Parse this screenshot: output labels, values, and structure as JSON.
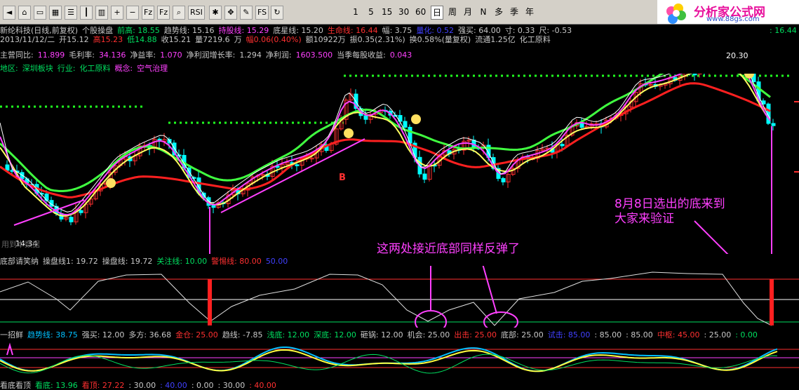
{
  "toolbar": {
    "icons": [
      "back-icon",
      "home-icon",
      "window-icon",
      "grid-icon",
      "list-icon",
      "candlestick-icon",
      "bar-chart-icon",
      "plus-icon",
      "minus-icon",
      "fz-icon",
      "fz2-icon",
      "magnify-icon",
      "rsi-icon",
      "gear-icon",
      "move-icon",
      "edit-icon",
      "fs-icon",
      "refresh-icon"
    ],
    "rsi_label": "RSI",
    "fs_label": "FS",
    "periods": [
      "1",
      "5",
      "15",
      "30",
      "60",
      "日",
      "周",
      "月",
      "N",
      "多",
      "季",
      "年"
    ],
    "active_period": "日"
  },
  "logo": {
    "text": "分析家公式网",
    "url": "www.88gs.com"
  },
  "header": {
    "line1": [
      {
        "t": "新纶科技(日线,前复权)",
        "c": "#c8c8c8"
      },
      {
        "t": "个股操盘",
        "c": "#c8c8c8"
      },
      {
        "t": "前高: 18.55",
        "c": "#00e060"
      },
      {
        "t": "趋势线: 15.16",
        "c": "#c8c8c8"
      },
      {
        "t": "持股线: 15.29",
        "c": "#ff40ff"
      },
      {
        "t": "底星线: 15.20",
        "c": "#c8c8c8"
      },
      {
        "t": "生命线: 16.44",
        "c": "#ff3030"
      },
      {
        "t": "幅: 3.75",
        "c": "#c8c8c8"
      },
      {
        "t": "量化: 0.52",
        "c": "#4040ff"
      },
      {
        "t": "强买: 64.00",
        "c": "#c8c8c8"
      },
      {
        "t": "寸: 0.33",
        "c": "#c8c8c8"
      },
      {
        "t": "尺: -0.53",
        "c": "#c8c8c8"
      }
    ],
    "right_value": ": 16.44",
    "line2": [
      {
        "t": "2013/11/12/二",
        "c": "#c8c8c8"
      },
      {
        "t": "开15.12",
        "c": "#c8c8c8"
      },
      {
        "t": "高15.23",
        "c": "#ff3030"
      },
      {
        "t": "低14.88",
        "c": "#00e060"
      },
      {
        "t": "收15.21",
        "c": "#c8c8c8"
      },
      {
        "t": "量7219.6",
        "c": "#c8c8c8"
      },
      {
        "t": "万",
        "c": "#c8c8c8"
      },
      {
        "t": "幅0.06(0.40%)",
        "c": "#ff3030"
      },
      {
        "t": "额10922万",
        "c": "#c8c8c8"
      },
      {
        "t": "振0.35(2.31%)",
        "c": "#c8c8c8"
      },
      {
        "t": "换0.58%(量复权)",
        "c": "#c8c8c8"
      },
      {
        "t": "流通1.25亿",
        "c": "#c8c8c8"
      },
      {
        "t": "化工原料",
        "c": "#c8c8c8"
      }
    ],
    "line3": [
      {
        "t": "主营同比:",
        "c": "#c8c8c8"
      },
      {
        "t": "11.899",
        "c": "#ff40ff"
      },
      {
        "t": "毛利率:",
        "c": "#c8c8c8"
      },
      {
        "t": "34.136",
        "c": "#ff40ff"
      },
      {
        "t": "净益率:",
        "c": "#c8c8c8"
      },
      {
        "t": "1.070",
        "c": "#ff40ff"
      },
      {
        "t": "净利润增长率:",
        "c": "#c8c8c8"
      },
      {
        "t": "1.294",
        "c": "#c8c8c8"
      },
      {
        "t": "净利润:",
        "c": "#c8c8c8"
      },
      {
        "t": "1603.500",
        "c": "#ff40ff"
      },
      {
        "t": "当季每股收益:",
        "c": "#c8c8c8"
      },
      {
        "t": "0.043",
        "c": "#ff40ff"
      }
    ],
    "line4": [
      {
        "t": "地区:",
        "c": "#00e060"
      },
      {
        "t": "深圳板块",
        "c": "#00e060"
      },
      {
        "t": "行业:",
        "c": "#00e060"
      },
      {
        "t": "化工原料",
        "c": "#00e060"
      },
      {
        "t": "概念:",
        "c": "#ff40ff"
      },
      {
        "t": "空气治理",
        "c": "#ff40ff"
      }
    ]
  },
  "main_chart": {
    "peak_label": "20.30",
    "low_label": "14.34",
    "watermark": "用到本数据",
    "marker_b": "B",
    "annotation_right": [
      "8月8日选出的底来到",
      "大家来验证"
    ],
    "annotation_mid": "这两处接近底部同样反弹了"
  },
  "sub1": {
    "title": "底部请笑纳",
    "items": [
      {
        "t": "操盘线1: 19.72",
        "c": "#c8c8c8"
      },
      {
        "t": "操盘线: 19.72",
        "c": "#c8c8c8"
      },
      {
        "t": "关注线: 10.00",
        "c": "#00e060"
      },
      {
        "t": "警惕线: 80.00",
        "c": "#ff3030"
      },
      {
        "t": "50.00",
        "c": "#4040ff"
      }
    ]
  },
  "sub2": {
    "items": [
      {
        "t": "一招鲜",
        "c": "#c8c8c8"
      },
      {
        "t": "趋势线: 38.75",
        "c": "#00c0ff"
      },
      {
        "t": "强买: 12.00",
        "c": "#c8c8c8"
      },
      {
        "t": "多方: 36.68",
        "c": "#c8c8c8"
      },
      {
        "t": "金仓: 25.00",
        "c": "#ff3030"
      },
      {
        "t": "趋线: -7.85",
        "c": "#c8c8c8"
      },
      {
        "t": "浅底: 12.00",
        "c": "#00e060"
      },
      {
        "t": "深底: 12.00",
        "c": "#00e060"
      },
      {
        "t": "砸锅: 12.00",
        "c": "#c8c8c8"
      },
      {
        "t": "机会: 25.00",
        "c": "#c8c8c8"
      },
      {
        "t": "出击: 25.00",
        "c": "#ff3030"
      },
      {
        "t": "底部: 25.00",
        "c": "#c8c8c8"
      },
      {
        "t": "试击: 85.00",
        "c": "#4040ff"
      },
      {
        "t": ": 85.00",
        "c": "#c8c8c8"
      },
      {
        "t": ": 85.00",
        "c": "#c8c8c8"
      },
      {
        "t": "中枢: 45.00",
        "c": "#ff3030"
      },
      {
        "t": ": 25.00",
        "c": "#c8c8c8"
      },
      {
        "t": ": 0.00",
        "c": "#00e060"
      }
    ]
  },
  "sub3": {
    "items": [
      {
        "t": "看底看顶",
        "c": "#c8c8c8"
      },
      {
        "t": "看底: 13.96",
        "c": "#00e060"
      },
      {
        "t": "看顶: 27.22",
        "c": "#ff3030"
      },
      {
        "t": ": 30.00",
        "c": "#c8c8c8"
      },
      {
        "t": ": 40.00",
        "c": "#4040ff"
      },
      {
        "t": ": 0.00",
        "c": "#c8c8c8"
      },
      {
        "t": ": 30.00",
        "c": "#c8c8c8"
      },
      {
        "t": ": 40.00",
        "c": "#ff3030"
      }
    ]
  }
}
